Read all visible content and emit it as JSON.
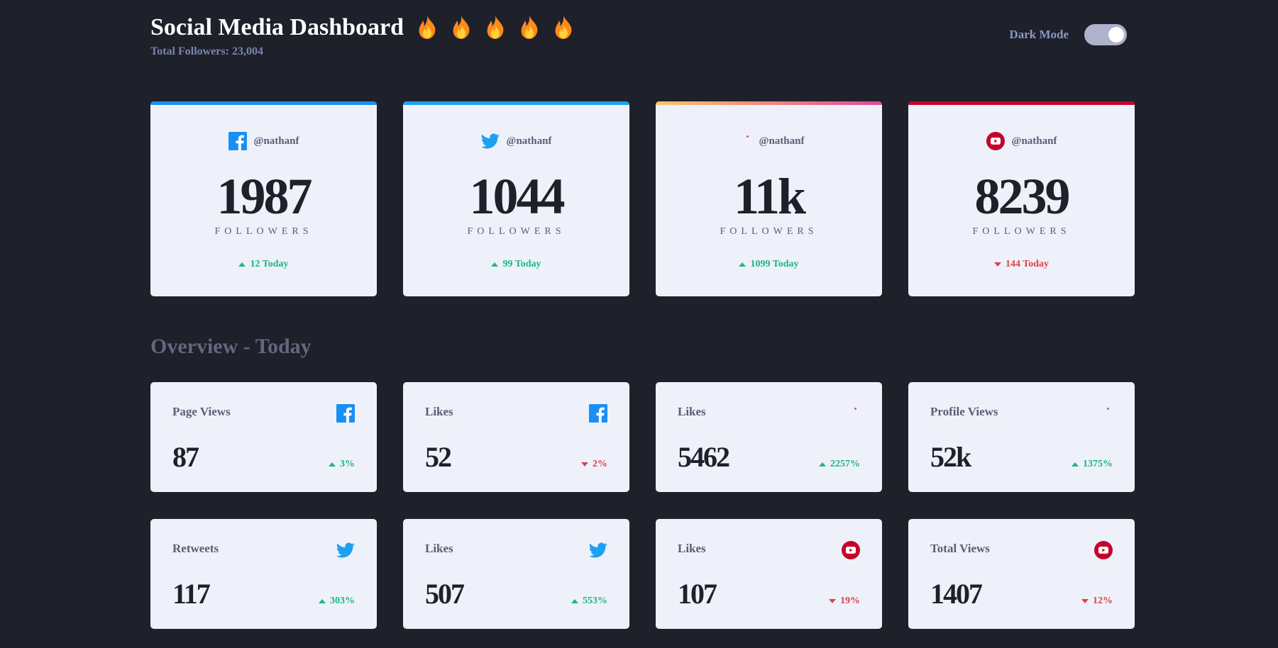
{
  "header": {
    "title": "Social Media Dashboard",
    "total_followers": "Total Followers: 23,004",
    "flame_count": 5,
    "dark_mode_label": "Dark Mode",
    "dark_mode_on": true
  },
  "colors": {
    "background": "#1e202a",
    "card": "#eef1fa",
    "facebook": "#198ff5",
    "twitter": "#1ca0f2",
    "instagram_start": "#fdc468",
    "instagram_end": "#df4996",
    "youtube": "#c4032a",
    "positive": "#1db489",
    "negative": "#dc414c"
  },
  "follower_cards": [
    {
      "platform": "facebook",
      "icon": "facebook-icon",
      "handle": "@nathanf",
      "count": "1987",
      "label": "FOLLOWERS",
      "today": "12 Today",
      "trend": "up"
    },
    {
      "platform": "twitter",
      "icon": "twitter-icon",
      "handle": "@nathanf",
      "count": "1044",
      "label": "FOLLOWERS",
      "today": "99 Today",
      "trend": "up"
    },
    {
      "platform": "instagram",
      "icon": "instagram-icon",
      "handle": "@nathanf",
      "count": "11k",
      "label": "FOLLOWERS",
      "today": "1099 Today",
      "trend": "up"
    },
    {
      "platform": "youtube",
      "icon": "youtube-icon",
      "handle": "@nathanf",
      "count": "8239",
      "label": "FOLLOWERS",
      "today": "144 Today",
      "trend": "down"
    }
  ],
  "overview": {
    "title": "Overview - Today",
    "cards": [
      {
        "label": "Page Views",
        "icon": "facebook-icon",
        "value": "87",
        "change": "3%",
        "trend": "up"
      },
      {
        "label": "Likes",
        "icon": "facebook-icon",
        "value": "52",
        "change": "2%",
        "trend": "down"
      },
      {
        "label": "Likes",
        "icon": "instagram-icon",
        "value": "5462",
        "change": "2257%",
        "trend": "up"
      },
      {
        "label": "Profile Views",
        "icon": "instagram-icon",
        "value": "52k",
        "change": "1375%",
        "trend": "up"
      },
      {
        "label": "Retweets",
        "icon": "twitter-icon",
        "value": "117",
        "change": "303%",
        "trend": "up"
      },
      {
        "label": "Likes",
        "icon": "twitter-icon",
        "value": "507",
        "change": "553%",
        "trend": "up"
      },
      {
        "label": "Likes",
        "icon": "youtube-icon",
        "value": "107",
        "change": "19%",
        "trend": "down"
      },
      {
        "label": "Total Views",
        "icon": "youtube-icon",
        "value": "1407",
        "change": "12%",
        "trend": "down"
      }
    ]
  }
}
